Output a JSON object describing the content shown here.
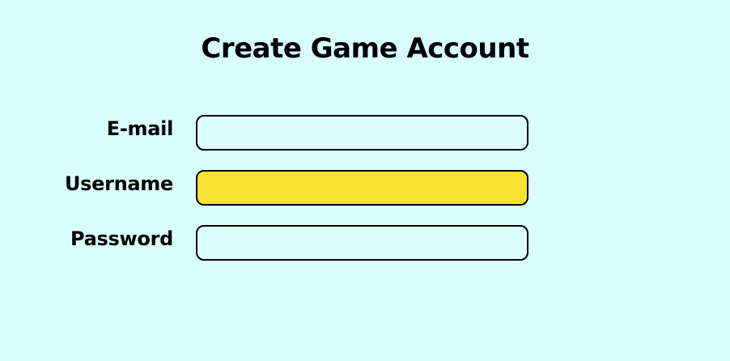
{
  "page": {
    "title": "Create Game Account"
  },
  "form": {
    "fields": [
      {
        "label": "E-mail",
        "value": "",
        "placeholder": ""
      },
      {
        "label": "Username",
        "value": "",
        "placeholder": "",
        "highlighted": true
      },
      {
        "label": "Password",
        "value": "",
        "placeholder": ""
      }
    ]
  },
  "colors": {
    "background": "#d9fffd",
    "field_background": "#dafffd",
    "highlight": "#f7e22f",
    "border": "#000000"
  }
}
